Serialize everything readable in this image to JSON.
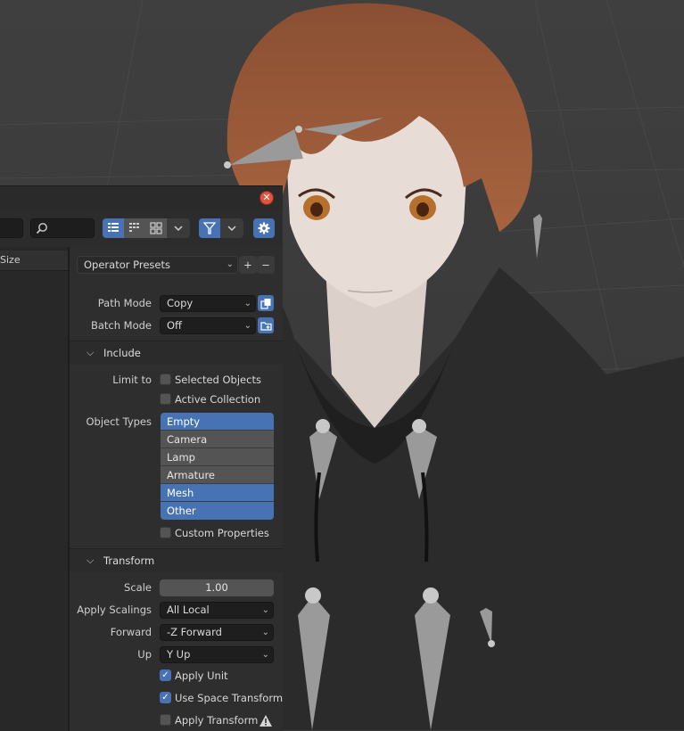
{
  "toolbar": {
    "search_icon": "search-icon",
    "display_modes": [
      "list-vertical-icon",
      "list-horizontal-icon",
      "thumbnails-icon"
    ],
    "filter_icon": "filter-icon",
    "settings_icon": "gear-icon"
  },
  "file_list": {
    "column_header": "Size"
  },
  "presets": {
    "label": "Operator Presets",
    "add": "+",
    "remove": "−"
  },
  "path_mode": {
    "label": "Path Mode",
    "value": "Copy"
  },
  "batch_mode": {
    "label": "Batch Mode",
    "value": "Off"
  },
  "include": {
    "header": "Include",
    "limit_to_label": "Limit to",
    "selected_objects": {
      "label": "Selected Objects",
      "checked": false
    },
    "active_collection": {
      "label": "Active Collection",
      "checked": false
    },
    "object_types_label": "Object Types",
    "object_types": [
      {
        "label": "Empty",
        "selected": true
      },
      {
        "label": "Camera",
        "selected": false
      },
      {
        "label": "Lamp",
        "selected": false
      },
      {
        "label": "Armature",
        "selected": false
      },
      {
        "label": "Mesh",
        "selected": true
      },
      {
        "label": "Other",
        "selected": true
      }
    ],
    "custom_properties": {
      "label": "Custom Properties",
      "checked": false
    }
  },
  "transform": {
    "header": "Transform",
    "scale": {
      "label": "Scale",
      "value": "1.00"
    },
    "apply_scalings": {
      "label": "Apply Scalings",
      "value": "All Local"
    },
    "forward": {
      "label": "Forward",
      "value": "-Z Forward"
    },
    "up": {
      "label": "Up",
      "value": "Y Up"
    },
    "apply_unit": {
      "label": "Apply Unit",
      "checked": true
    },
    "use_space_transform": {
      "label": "Use Space Transform",
      "checked": true
    },
    "apply_transform": {
      "label": "Apply Transform",
      "checked": false,
      "icon": "warning-icon"
    }
  },
  "colors": {
    "accent": "#4772b3",
    "close": "#e0533f",
    "panel": "#2e2e2e"
  }
}
